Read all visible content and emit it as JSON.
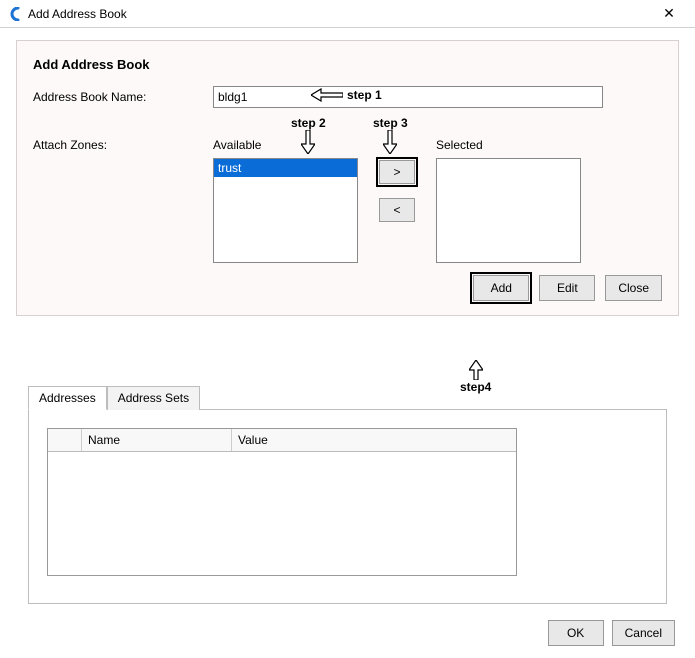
{
  "window": {
    "title": "Add Address Book",
    "close_glyph": "✕"
  },
  "form": {
    "heading": "Add Address Book",
    "name_label": "Address Book Name:",
    "name_value": "bldg1",
    "zones_label": "Attach Zones:",
    "available_label": "Available",
    "selected_label": "Selected",
    "available_items": [
      "trust"
    ],
    "selected_items": [],
    "move_right": ">",
    "move_left": "<",
    "add": "Add",
    "edit": "Edit",
    "close": "Close"
  },
  "tabs": {
    "addresses": "Addresses",
    "address_sets": "Address Sets"
  },
  "grid": {
    "col_select": "",
    "col_name": "Name",
    "col_value": "Value"
  },
  "footer": {
    "ok": "OK",
    "cancel": "Cancel"
  },
  "annotations": {
    "step1": "step 1",
    "step2": "step 2",
    "step3": "step 3",
    "step4": "step4"
  }
}
